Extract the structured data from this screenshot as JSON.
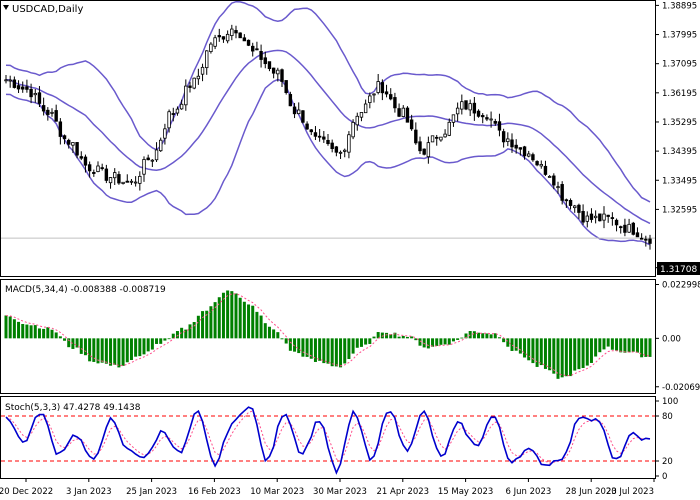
{
  "main": {
    "symbol_label": "USDCAD,Daily",
    "current_price": "1.31708",
    "y_ticks": [
      {
        "label": "1.38895",
        "value": 1.38895
      },
      {
        "label": "1.37995",
        "value": 1.37995
      },
      {
        "label": "1.37095",
        "value": 1.37095
      },
      {
        "label": "1.36195",
        "value": 1.36195
      },
      {
        "label": "1.35295",
        "value": 1.35295
      },
      {
        "label": "1.34395",
        "value": 1.34395
      },
      {
        "label": "1.33495",
        "value": 1.33495
      },
      {
        "label": "1.32595",
        "value": 1.32595
      },
      {
        "label": "1.30795",
        "value": 1.30795
      }
    ],
    "ylim": [
      1.306,
      1.39
    ]
  },
  "macd": {
    "label": "MACD(5,34,4) -0.008388 -0.008719",
    "y_ticks": [
      {
        "label": "0.022998",
        "value": 0.022998
      },
      {
        "label": "0.00",
        "value": 0
      },
      {
        "label": "-0.020691",
        "value": -0.020691
      }
    ],
    "ylim": [
      -0.0225,
      0.0245
    ]
  },
  "stoch": {
    "label": "Stoch(5,3,3) 47.4278 49.1438",
    "y_ticks": [
      {
        "label": "100",
        "value": 100
      },
      {
        "label": "80",
        "value": 80
      },
      {
        "label": "20",
        "value": 20
      },
      {
        "label": "0",
        "value": 0
      }
    ],
    "levels": [
      80,
      20
    ]
  },
  "x_labels": [
    "20 Dec 2022",
    "3 Jan 2023",
    "25 Jan 2023",
    "16 Feb 2023",
    "10 Mar 2023",
    "30 Mar 2023",
    "21 Apr 2023",
    "15 May 2023",
    "6 Jun 2023",
    "28 Jun 2023",
    "20 Jul 2023"
  ],
  "colors": {
    "band": "#6a5acd",
    "macd_bar": "#008000",
    "macd_signal": "#ff4f8b",
    "stoch_main": "#0000cd",
    "stoch_signal": "#ff4f8b",
    "level_line": "#ff0000",
    "candle": "#000000"
  },
  "chart_data": [
    {
      "type": "candlestick",
      "title": "USDCAD,Daily",
      "indicator": "Bollinger Bands",
      "x": [
        "20 Dec 2022",
        "3 Jan 2023",
        "25 Jan 2023",
        "16 Feb 2023",
        "10 Mar 2023",
        "30 Mar 2023",
        "21 Apr 2023",
        "15 May 2023",
        "6 Jun 2023",
        "28 Jun 2023",
        "20 Jul 2023"
      ],
      "close_approx": [
        1.366,
        1.354,
        1.337,
        1.352,
        1.376,
        1.352,
        1.362,
        1.35,
        1.339,
        1.323,
        1.3171
      ],
      "ylim": [
        1.306,
        1.39
      ]
    },
    {
      "type": "bar",
      "title": "MACD(5,34,4) -0.008388 -0.008719",
      "x": [
        "20 Dec 2022",
        "3 Jan 2023",
        "25 Jan 2023",
        "16 Feb 2023",
        "10 Mar 2023",
        "30 Mar 2023",
        "21 Apr 2023",
        "15 May 2023",
        "6 Jun 2023",
        "28 Jun 2023",
        "20 Jul 2023"
      ],
      "values_approx": [
        0.01,
        -0.005,
        -0.012,
        0.004,
        0.02,
        -0.01,
        0.005,
        0.002,
        -0.008,
        -0.018,
        -0.008
      ],
      "ylim": [
        -0.020691,
        0.022998
      ]
    },
    {
      "type": "line",
      "title": "Stoch(5,3,3) 47.4278 49.1438",
      "x": [
        "20 Dec 2022",
        "3 Jan 2023",
        "25 Jan 2023",
        "16 Feb 2023",
        "10 Mar 2023",
        "30 Mar 2023",
        "21 Apr 2023",
        "15 May 2023",
        "6 Jun 2023",
        "28 Jun 2023",
        "20 Jul 2023"
      ],
      "values_approx": [
        85,
        20,
        75,
        15,
        95,
        5,
        90,
        30,
        15,
        85,
        47
      ],
      "ylim": [
        0,
        100
      ]
    }
  ]
}
